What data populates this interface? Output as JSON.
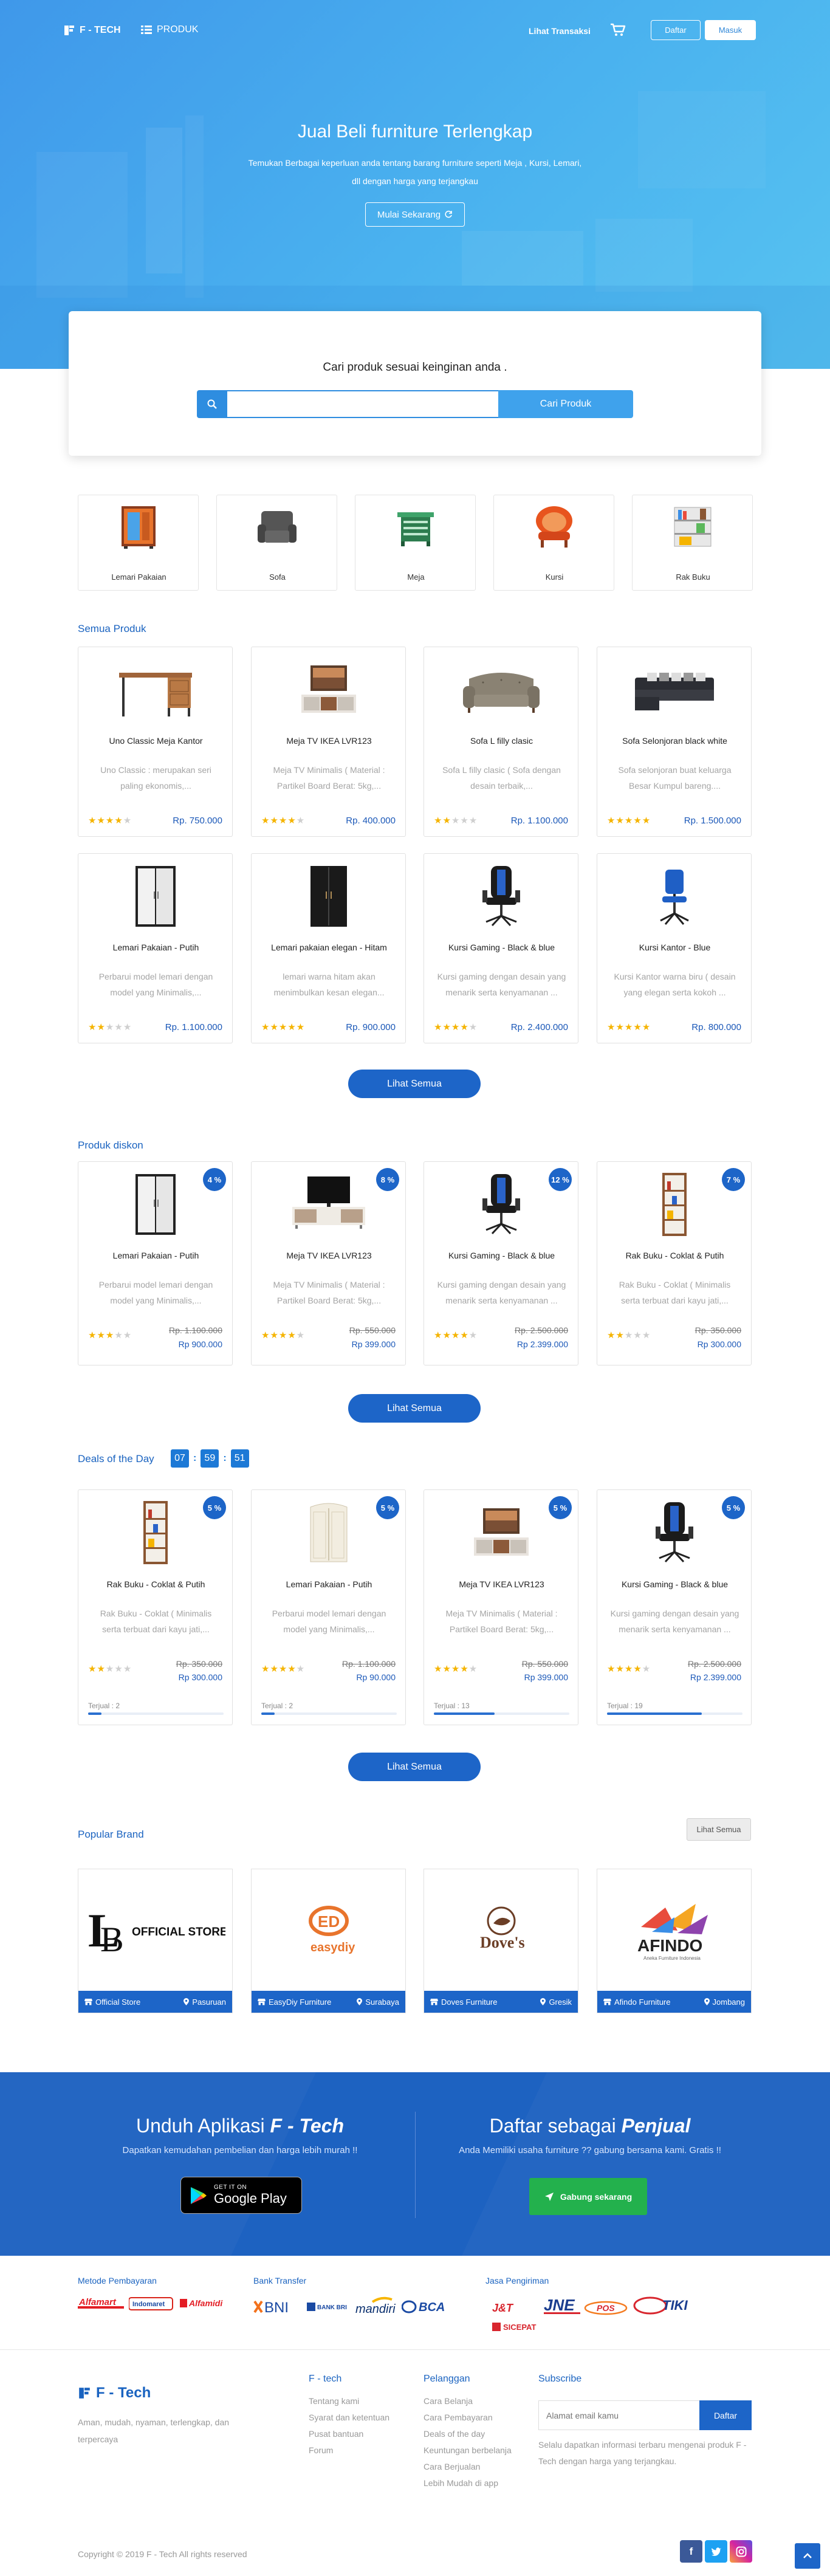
{
  "nav": {
    "logo": "F - TECH",
    "produk": "PRODUK",
    "transaksi": "Lihat Transaksi",
    "daftar": "Daftar",
    "masuk": "Masuk"
  },
  "hero": {
    "title": "Jual Beli furniture Terlengkap",
    "desc": "Temukan Berbagai keperluan anda tentang barang furniture seperti Meja , Kursi, Lemari, dll dengan harga yang terjangkau",
    "button": "Mulai Sekarang"
  },
  "search": {
    "title": "Cari produk sesuai keinginan anda .",
    "placeholder": "",
    "button": "Cari Produk"
  },
  "categories": [
    {
      "label": "Lemari Pakaian",
      "icon": "wardrobe-icon"
    },
    {
      "label": "Sofa",
      "icon": "sofa-icon"
    },
    {
      "label": "Meja",
      "icon": "table-icon"
    },
    {
      "label": "Kursi",
      "icon": "chair-icon"
    },
    {
      "label": "Rak Buku",
      "icon": "bookshelf-icon"
    }
  ],
  "semua_produk": {
    "title": "Semua Produk",
    "items": [
      {
        "name": "Uno Classic Meja Kantor",
        "desc": "Uno Classic : merupakan seri paling ekonomis,...",
        "rating": 4,
        "price": "Rp. 750.000",
        "img": "desk"
      },
      {
        "name": "Meja TV IKEA LVR123",
        "desc": "Meja TV Minimalis ( Material : Partikel Board Berat: 5kg,...",
        "rating": 4,
        "price": "Rp. 400.000",
        "img": "tvstand"
      },
      {
        "name": "Sofa L filly clasic",
        "desc": "Sofa L filly clasic ( Sofa dengan desain terbaik,...",
        "rating": 2,
        "price": "Rp. 1.100.000",
        "img": "sofa"
      },
      {
        "name": "Sofa Selonjoran black white",
        "desc": "Sofa selonjoran buat keluarga Besar Kumpul bareng....",
        "rating": 5,
        "price": "Rp. 1.500.000",
        "img": "lsofa"
      },
      {
        "name": "Lemari Pakaian - Putih",
        "desc": "Perbarui model lemari dengan model yang Minimalis,...",
        "rating": 2,
        "price": "Rp. 1.100.000",
        "img": "wardrobe_white"
      },
      {
        "name": "Lemari pakaian elegan - Hitam",
        "desc": "lemari warna hitam akan menimbulkan kesan elegan...",
        "rating": 5,
        "price": "Rp. 900.000",
        "img": "wardrobe_black"
      },
      {
        "name": "Kursi Gaming - Black & blue",
        "desc": "Kursi gaming dengan desain yang menarik serta kenyamanan ...",
        "rating": 4,
        "price": "Rp. 2.400.000",
        "img": "gaming_chair"
      },
      {
        "name": "Kursi Kantor - Blue",
        "desc": "Kursi Kantor warna biru ( desain yang elegan serta kokoh ...",
        "rating": 5,
        "price": "Rp. 800.000",
        "img": "office_chair"
      }
    ],
    "button": "Lihat Semua"
  },
  "produk_diskon": {
    "title": "Produk diskon",
    "items": [
      {
        "name": "Lemari Pakaian - Putih",
        "desc": "Perbarui model lemari dengan model yang Minimalis,...",
        "rating": 3,
        "old": "Rp. 1.100.000",
        "new": "Rp 900.000",
        "badge": "4 %",
        "img": "wardrobe_white"
      },
      {
        "name": "Meja TV IKEA LVR123",
        "desc": "Meja TV Minimalis ( Material : Partikel Board Berat: 5kg,...",
        "rating": 4,
        "old": "Rp. 550.000",
        "new": "Rp 399.000",
        "badge": "8 %",
        "img": "tvstand_tv"
      },
      {
        "name": "Kursi Gaming - Black & blue",
        "desc": "Kursi gaming dengan desain yang menarik serta kenyamanan ...",
        "rating": 4,
        "old": "Rp. 2.500.000",
        "new": "Rp 2.399.000",
        "badge": "12 %",
        "img": "gaming_chair"
      },
      {
        "name": "Rak Buku - Coklat & Putih",
        "desc": "Rak Buku - Coklat ( Minimalis serta terbuat dari kayu jati,...",
        "rating": 2,
        "old": "Rp. 350.000",
        "new": "Rp 300.000",
        "badge": "7 %",
        "img": "bookshelf"
      }
    ],
    "button": "Lihat Semua"
  },
  "deals": {
    "title": "Deals of the Day",
    "timer": [
      "07",
      "59",
      "51"
    ],
    "items": [
      {
        "name": "Rak Buku - Coklat & Putih",
        "desc": "Rak Buku - Coklat ( Minimalis serta terbuat dari kayu jati,...",
        "rating": 2,
        "old": "Rp. 350.000",
        "new": "Rp 300.000",
        "badge": "5 %",
        "sold": "Terjual : 2",
        "progress": 0.1,
        "img": "bookshelf"
      },
      {
        "name": "Lemari Pakaian - Putih",
        "desc": "Perbarui model lemari dengan model yang Minimalis,...",
        "rating": 4,
        "old": "Rp. 1.100.000",
        "new": "Rp 90.000",
        "badge": "5 %",
        "sold": "Terjual : 2",
        "progress": 0.1,
        "img": "wardrobe_cream"
      },
      {
        "name": "Meja TV IKEA LVR123",
        "desc": "Meja TV Minimalis ( Material : Partikel Board Berat: 5kg,...",
        "rating": 4,
        "old": "Rp. 550.000",
        "new": "Rp 399.000",
        "badge": "5 %",
        "sold": "Terjual : 13",
        "progress": 0.45,
        "img": "tvstand"
      },
      {
        "name": "Kursi Gaming - Black & blue",
        "desc": "Kursi gaming dengan desain yang menarik serta kenyamanan ...",
        "rating": 4,
        "old": "Rp. 2.500.000",
        "new": "Rp 2.399.000",
        "badge": "5 %",
        "sold": "Terjual : 19",
        "progress": 0.7,
        "img": "gaming_chair"
      }
    ],
    "button": "Lihat Semua"
  },
  "brands": {
    "title": "Popular Brand",
    "button": "Lihat Semua",
    "items": [
      {
        "logo": "OFFICIAL STORE",
        "name": "Official Store",
        "city": "Pasuruan"
      },
      {
        "logo": "easydiy",
        "name": "EasyDiy Furniture",
        "city": "Surabaya"
      },
      {
        "logo": "Dove's",
        "name": "Doves Furniture",
        "city": "Gresik"
      },
      {
        "logo": "AFINDO",
        "sub": "Aneka Furniture Indonesia",
        "name": "Afindo Furniture",
        "city": "Jombang"
      }
    ]
  },
  "banner": {
    "left_title_pre": "Unduh Aplikasi ",
    "left_title_em": "F - Tech",
    "left_sub": "Dapatkan kemudahan pembelian dan harga lebih murah !!",
    "gp_small": "GET IT ON",
    "gp_big": "Google Play",
    "right_title_pre": "Daftar sebagai ",
    "right_title_em": "Penjual",
    "right_sub": "Anda Memiliki usaha furniture ?? gabung bersama kami. Gratis !!",
    "gabung": "Gabung sekarang"
  },
  "payments": {
    "metode": "Metode Pembayaran",
    "bank": "Bank Transfer",
    "jasa": "Jasa Pengiriman",
    "metode_logos": [
      "Alfamart",
      "Indomaret",
      "Alfamidi"
    ],
    "bank_logos": [
      "BNI",
      "BANK BRI",
      "mandiri",
      "BCA"
    ],
    "jasa_logos": [
      "J&T",
      "JNE",
      "POS",
      "TIKI",
      "SICEPAT"
    ]
  },
  "footer": {
    "logo": "F - Tech",
    "desc": "Aman, mudah, nyaman, terlengkap, dan terpercaya",
    "col1_title": "F - tech",
    "col1": [
      "Tentang kami",
      "Syarat dan ketentuan",
      "Pusat bantuan",
      "Forum"
    ],
    "col2_title": "Pelanggan",
    "col2": [
      "Cara Belanja",
      "Cara Pembayaran",
      "Deals of the day",
      "Keuntungan berbelanja",
      "Cara Berjualan",
      "Lebih Mudah di app"
    ],
    "sub_title": "Subscribe",
    "sub_placeholder": "Alamat email kamu",
    "sub_button": "Daftar",
    "sub_desc": "Selalu dapatkan informasi terbaru mengenai produk F - Tech dengan harga yang terjangkau.",
    "copyright": "Copyright © 2019 F - Tech All rights reserved",
    "social": [
      "facebook-icon",
      "twitter-icon",
      "instagram-icon"
    ]
  },
  "colors": {
    "brand": "#1d65c8",
    "hero": "#4ab2ef",
    "star": "#f5b400",
    "green": "#23b14d"
  }
}
